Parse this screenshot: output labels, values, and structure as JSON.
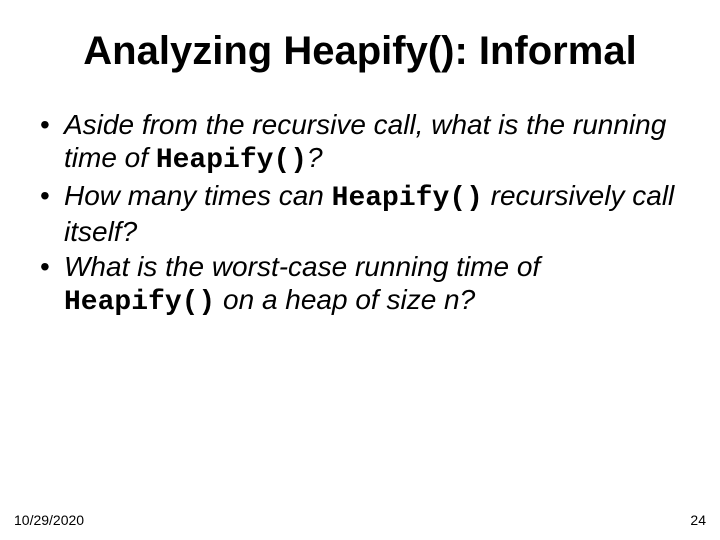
{
  "slide": {
    "title": "Analyzing Heapify(): Informal",
    "bullets": [
      {
        "pre": "Aside from the recursive call, what is the running time of ",
        "code": "Heapify()",
        "post": "?"
      },
      {
        "pre": "How many times can ",
        "code": "Heapify()",
        "post": " recursively call itself?"
      },
      {
        "pre": "What is the worst-case running time of ",
        "code": "Heapify()",
        "post": " on a heap of size n?"
      }
    ],
    "footer": {
      "date": "10/29/2020",
      "page": "24"
    }
  }
}
